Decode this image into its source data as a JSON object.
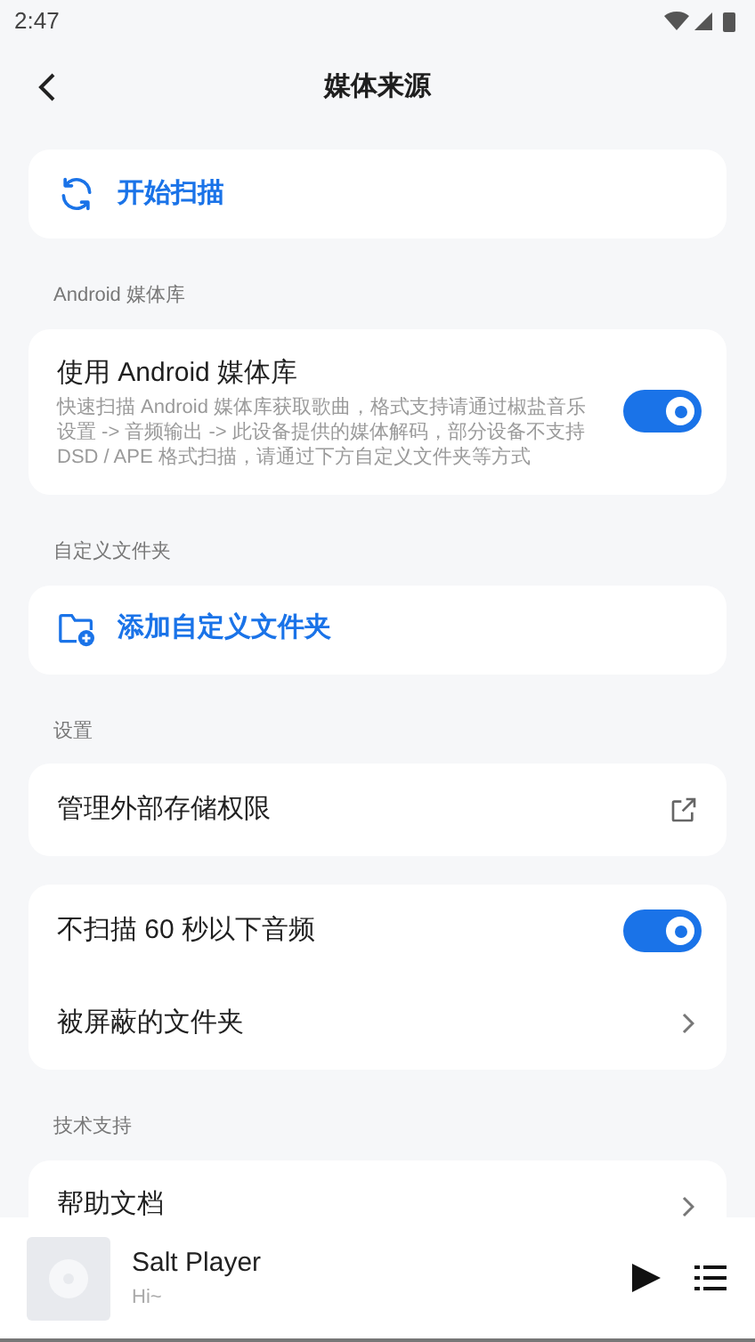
{
  "status_bar": {
    "time": "2:47"
  },
  "header": {
    "title": "媒体来源"
  },
  "sections": [
    {
      "items": [
        {
          "kind": "scan",
          "label": "开始扫描"
        }
      ]
    },
    {
      "heading": "Android 媒体库",
      "items": [
        {
          "kind": "toggle",
          "label": "使用 Android 媒体库",
          "description": "快速扫描 Android 媒体库获取歌曲，格式支持请通过椒盐音乐设置 -> 音频输出 -> 此设备提供的媒体解码，部分设备不支持 DSD / APE 格式扫描，请通过下方自定义文件夹等方式",
          "on": true
        }
      ]
    },
    {
      "heading": "自定义文件夹",
      "items": [
        {
          "kind": "add_folder",
          "label": "添加自定义文件夹"
        }
      ]
    },
    {
      "heading": "设置",
      "items": [
        {
          "kind": "external",
          "label": "管理外部存储权限"
        }
      ]
    },
    {
      "items": [
        {
          "kind": "toggle",
          "label": "不扫描 60 秒以下音频",
          "on": true
        },
        {
          "kind": "nav",
          "label": "被屏蔽的文件夹"
        }
      ]
    },
    {
      "heading": "技术支持",
      "items": [
        {
          "kind": "nav",
          "label": "帮助文档"
        }
      ]
    }
  ],
  "mini_player": {
    "title": "Salt Player",
    "subtitle": "Hi~"
  }
}
